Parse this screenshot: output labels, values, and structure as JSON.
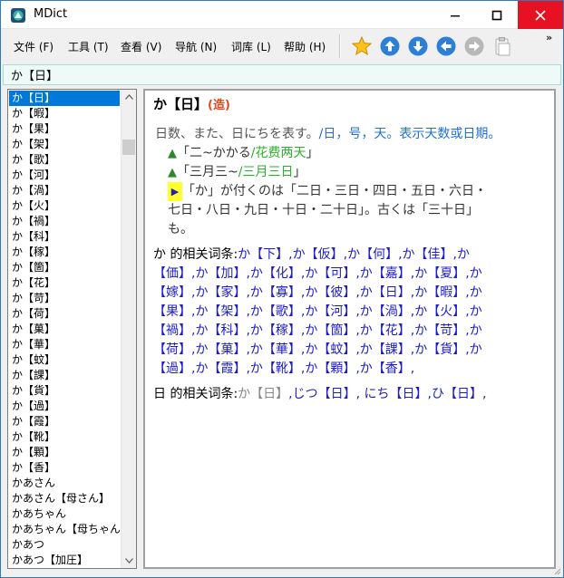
{
  "window": {
    "title": "MDict"
  },
  "menu": {
    "items": [
      "文件 (F)",
      "工具 (T)",
      "查看 (V)",
      "导航 (N)",
      "词库 (L)",
      "帮助 (H)"
    ]
  },
  "toolbar": {
    "icons": [
      "star-icon",
      "arrow-up-icon",
      "arrow-down-icon",
      "arrow-left-icon",
      "arrow-right-icon",
      "clipboard-icon"
    ],
    "overflow": "»"
  },
  "search": {
    "value": "か【日】"
  },
  "word_list": {
    "selected_index": 0,
    "items": [
      "か【日】",
      "か【暇】",
      "か【果】",
      "か【架】",
      "か【歌】",
      "か【河】",
      "か【渦】",
      "か【火】",
      "か【禍】",
      "か【科】",
      "か【稼】",
      "か【箇】",
      "か【花】",
      "か【苛】",
      "か【荷】",
      "か【菓】",
      "か【華】",
      "か【蚊】",
      "か【課】",
      "か【貨】",
      "か【過】",
      "か【霞】",
      "か【靴】",
      "か【顆】",
      "か【香】",
      "かあさん",
      "かあさん【母さん】",
      "かあちゃん",
      "かあちゃん【母ちゃん】",
      "かあつ",
      "かあつ【加圧】"
    ]
  },
  "entry": {
    "head": "か【日】",
    "tag": "(造)",
    "definition_jp": "日数、また、日にちを表す。",
    "definition_cn": "/日，号，天。表示天数或日期。",
    "examples": [
      {
        "marker": "▲",
        "jp": "「二~かかる",
        "cn": "/花费两天",
        "end": "」"
      },
      {
        "marker": "▲",
        "jp": "「三月三~",
        "cn": "/三月三日",
        "end": "」"
      }
    ],
    "note_marker": "▶",
    "note_line1": "「か」が付くのは「二日・三日・四日・五日・六日・",
    "note_line2": "七日・八日・九日・十日・二十日」。古くは「三十日」",
    "note_line3": "も。",
    "related1": {
      "label": "か 的相关词条:",
      "lines": [
        "か【下】,か【仮】,か【何】,か【佳】,か",
        "【価】,か【加】,か【化】,か【可】,か【嘉】,か【夏】,か",
        "【嫁】,か【家】,か【寡】,か【彼】,か【日】,か【暇】,か",
        "【果】,か【架】,か【歌】,か【河】,か【渦】,か【火】,か",
        "【禍】,か【科】,か【稼】,か【箇】,か【花】,か【苛】,か",
        "【荷】,か【菓】,か【華】,か【蚊】,か【課】,か【貨】,か",
        "【過】,か【霞】,か【靴】,か【顆】,か【香】,"
      ]
    },
    "related2": {
      "label": "日 的相关词条:",
      "current": "か【日】",
      "rest": ",じつ【日】, にち【日】,ひ【日】,"
    }
  },
  "colors": {
    "accent": "#0078d7",
    "close_red": "#e81123",
    "link_blue": "#1d1dc8",
    "cn_blue": "#1f6fd6",
    "tag_orange": "#e0471a",
    "example_green": "#2bb02b"
  }
}
